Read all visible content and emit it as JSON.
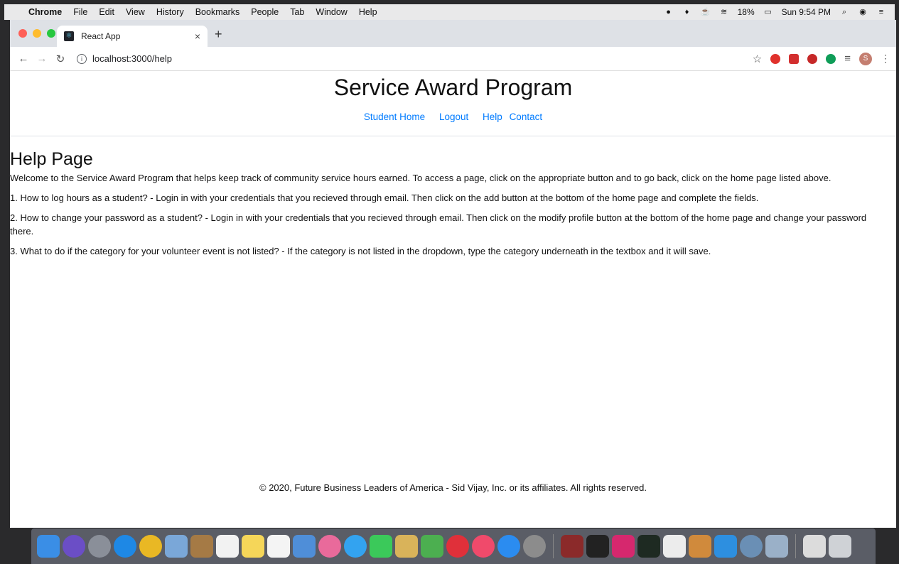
{
  "menubar": {
    "app": "Chrome",
    "items": [
      "File",
      "Edit",
      "View",
      "History",
      "Bookmarks",
      "People",
      "Tab",
      "Window",
      "Help"
    ],
    "battery": "18%",
    "clock": "Sun 9:54 PM"
  },
  "browser": {
    "tab_title": "React App",
    "url": "localhost:3000/help"
  },
  "site": {
    "title": "Service Award Program",
    "nav": [
      "Student Home",
      "Logout",
      "Help",
      "Contact"
    ]
  },
  "content": {
    "heading": "Help Page",
    "intro": "Welcome to the Service Award Program that helps keep track of community service hours earned. To access a page, click on the appropriate button and to go back, click on the home page listed above.",
    "faq": [
      "1. How to log hours as a student? - Login in with your credentials that you recieved through email. Then click on the add button at the bottom of the home page and complete the fields.",
      "2. How to change your password as a student? - Login in with your credentials that you recieved through email. Then click on the modify profile button at the bottom of the home page and change your password there.",
      "3. What to do if the category for your volunteer event is not listed? - If the category is not listed in the dropdown, type the category underneath in the textbox and it will save."
    ]
  },
  "footer": {
    "text": "© 2020, Future Business Leaders of America - Sid Vijay, Inc. or its affiliates. All rights reserved."
  },
  "profile_initial": "S",
  "colors": {
    "link": "#007bff",
    "close": "#fe5f57",
    "minimize": "#febc2e",
    "zoom": "#28c840"
  }
}
